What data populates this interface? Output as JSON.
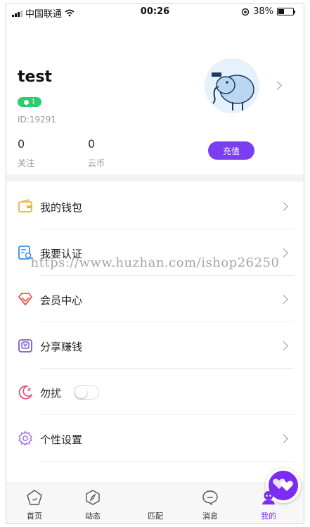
{
  "status_bar": {
    "carrier": "中国联通",
    "time": "00:26",
    "battery": "38%",
    "battery_level": 0.38
  },
  "profile": {
    "username": "test",
    "level": "1",
    "user_id": "ID:19291",
    "following_count": "0",
    "following_label": "关注",
    "coins_count": "0",
    "coins_label": "云币",
    "recharge_label": "充值"
  },
  "menu": {
    "wallet": "我的钱包",
    "verify": "我要认证",
    "vip": "会员中心",
    "share": "分享赚钱",
    "dnd": "勿扰",
    "dnd_enabled": false,
    "settings": "个性设置"
  },
  "watermark": "https://www.huzhan.com/ishop26250",
  "tabbar": {
    "home": "首页",
    "moments": "动态",
    "match": "匹配",
    "messages": "消息",
    "mine": "我的"
  },
  "colors": {
    "accent": "#7b3df0",
    "level_badge": "#2ecc71",
    "active_tab": "#7a2cf0",
    "wallet_icon": "#f0b33a",
    "verify_icon": "#3a8ee6",
    "vip_icon": "#e8554e",
    "share_icon": "#7b5cd6",
    "dnd_icon": "#e8557a",
    "settings_icon": "#a66de0"
  }
}
